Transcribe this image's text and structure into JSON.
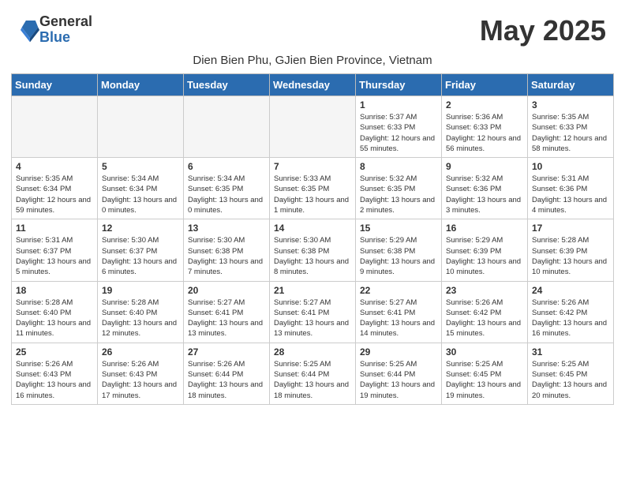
{
  "logo": {
    "general": "General",
    "blue": "Blue"
  },
  "title": "May 2025",
  "subtitle": "Dien Bien Phu, GJien Bien Province, Vietnam",
  "days_header": [
    "Sunday",
    "Monday",
    "Tuesday",
    "Wednesday",
    "Thursday",
    "Friday",
    "Saturday"
  ],
  "weeks": [
    [
      {
        "num": "",
        "empty": true
      },
      {
        "num": "",
        "empty": true
      },
      {
        "num": "",
        "empty": true
      },
      {
        "num": "",
        "empty": true
      },
      {
        "num": "1",
        "sunrise": "5:37 AM",
        "sunset": "6:33 PM",
        "daylight": "12 hours and 55 minutes."
      },
      {
        "num": "2",
        "sunrise": "5:36 AM",
        "sunset": "6:33 PM",
        "daylight": "12 hours and 56 minutes."
      },
      {
        "num": "3",
        "sunrise": "5:35 AM",
        "sunset": "6:33 PM",
        "daylight": "12 hours and 58 minutes."
      }
    ],
    [
      {
        "num": "4",
        "sunrise": "5:35 AM",
        "sunset": "6:34 PM",
        "daylight": "12 hours and 59 minutes."
      },
      {
        "num": "5",
        "sunrise": "5:34 AM",
        "sunset": "6:34 PM",
        "daylight": "13 hours and 0 minutes."
      },
      {
        "num": "6",
        "sunrise": "5:34 AM",
        "sunset": "6:35 PM",
        "daylight": "13 hours and 0 minutes."
      },
      {
        "num": "7",
        "sunrise": "5:33 AM",
        "sunset": "6:35 PM",
        "daylight": "13 hours and 1 minute."
      },
      {
        "num": "8",
        "sunrise": "5:32 AM",
        "sunset": "6:35 PM",
        "daylight": "13 hours and 2 minutes."
      },
      {
        "num": "9",
        "sunrise": "5:32 AM",
        "sunset": "6:36 PM",
        "daylight": "13 hours and 3 minutes."
      },
      {
        "num": "10",
        "sunrise": "5:31 AM",
        "sunset": "6:36 PM",
        "daylight": "13 hours and 4 minutes."
      }
    ],
    [
      {
        "num": "11",
        "sunrise": "5:31 AM",
        "sunset": "6:37 PM",
        "daylight": "13 hours and 5 minutes."
      },
      {
        "num": "12",
        "sunrise": "5:30 AM",
        "sunset": "6:37 PM",
        "daylight": "13 hours and 6 minutes."
      },
      {
        "num": "13",
        "sunrise": "5:30 AM",
        "sunset": "6:38 PM",
        "daylight": "13 hours and 7 minutes."
      },
      {
        "num": "14",
        "sunrise": "5:30 AM",
        "sunset": "6:38 PM",
        "daylight": "13 hours and 8 minutes."
      },
      {
        "num": "15",
        "sunrise": "5:29 AM",
        "sunset": "6:38 PM",
        "daylight": "13 hours and 9 minutes."
      },
      {
        "num": "16",
        "sunrise": "5:29 AM",
        "sunset": "6:39 PM",
        "daylight": "13 hours and 10 minutes."
      },
      {
        "num": "17",
        "sunrise": "5:28 AM",
        "sunset": "6:39 PM",
        "daylight": "13 hours and 10 minutes."
      }
    ],
    [
      {
        "num": "18",
        "sunrise": "5:28 AM",
        "sunset": "6:40 PM",
        "daylight": "13 hours and 11 minutes."
      },
      {
        "num": "19",
        "sunrise": "5:28 AM",
        "sunset": "6:40 PM",
        "daylight": "13 hours and 12 minutes."
      },
      {
        "num": "20",
        "sunrise": "5:27 AM",
        "sunset": "6:41 PM",
        "daylight": "13 hours and 13 minutes."
      },
      {
        "num": "21",
        "sunrise": "5:27 AM",
        "sunset": "6:41 PM",
        "daylight": "13 hours and 13 minutes."
      },
      {
        "num": "22",
        "sunrise": "5:27 AM",
        "sunset": "6:41 PM",
        "daylight": "13 hours and 14 minutes."
      },
      {
        "num": "23",
        "sunrise": "5:26 AM",
        "sunset": "6:42 PM",
        "daylight": "13 hours and 15 minutes."
      },
      {
        "num": "24",
        "sunrise": "5:26 AM",
        "sunset": "6:42 PM",
        "daylight": "13 hours and 16 minutes."
      }
    ],
    [
      {
        "num": "25",
        "sunrise": "5:26 AM",
        "sunset": "6:43 PM",
        "daylight": "13 hours and 16 minutes."
      },
      {
        "num": "26",
        "sunrise": "5:26 AM",
        "sunset": "6:43 PM",
        "daylight": "13 hours and 17 minutes."
      },
      {
        "num": "27",
        "sunrise": "5:26 AM",
        "sunset": "6:44 PM",
        "daylight": "13 hours and 18 minutes."
      },
      {
        "num": "28",
        "sunrise": "5:25 AM",
        "sunset": "6:44 PM",
        "daylight": "13 hours and 18 minutes."
      },
      {
        "num": "29",
        "sunrise": "5:25 AM",
        "sunset": "6:44 PM",
        "daylight": "13 hours and 19 minutes."
      },
      {
        "num": "30",
        "sunrise": "5:25 AM",
        "sunset": "6:45 PM",
        "daylight": "13 hours and 19 minutes."
      },
      {
        "num": "31",
        "sunrise": "5:25 AM",
        "sunset": "6:45 PM",
        "daylight": "13 hours and 20 minutes."
      }
    ]
  ]
}
